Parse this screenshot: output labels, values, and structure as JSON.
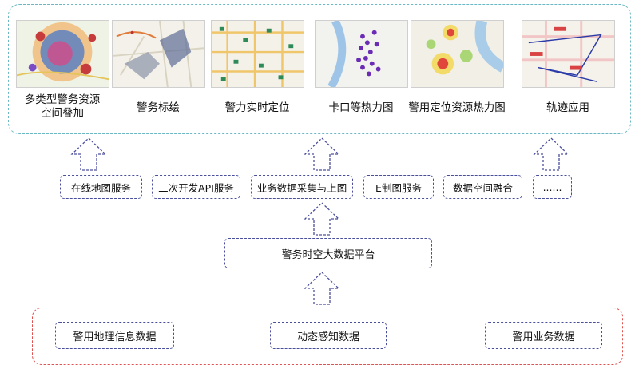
{
  "apps": [
    {
      "label": "多类型警务资源",
      "label2": "空间叠加"
    },
    {
      "label": "警务标绘"
    },
    {
      "label": "警力实时定位"
    },
    {
      "label": "卡口等热力图"
    },
    {
      "label": "警用定位资源热力图"
    },
    {
      "label": "轨迹应用"
    }
  ],
  "services": [
    "在线地图服务",
    "二次开发API服务",
    "业务数据采集与上图",
    "E制图服务",
    "数据空间融合",
    "......"
  ],
  "platform": "警务时空大数据平台",
  "sources": [
    "警用地理信息数据",
    "动态感知数据",
    "警用业务数据"
  ],
  "colors": {
    "top_frame": "#6bb7c4",
    "box_border": "#4a4f9c",
    "bottom_frame": "#e0524f"
  }
}
